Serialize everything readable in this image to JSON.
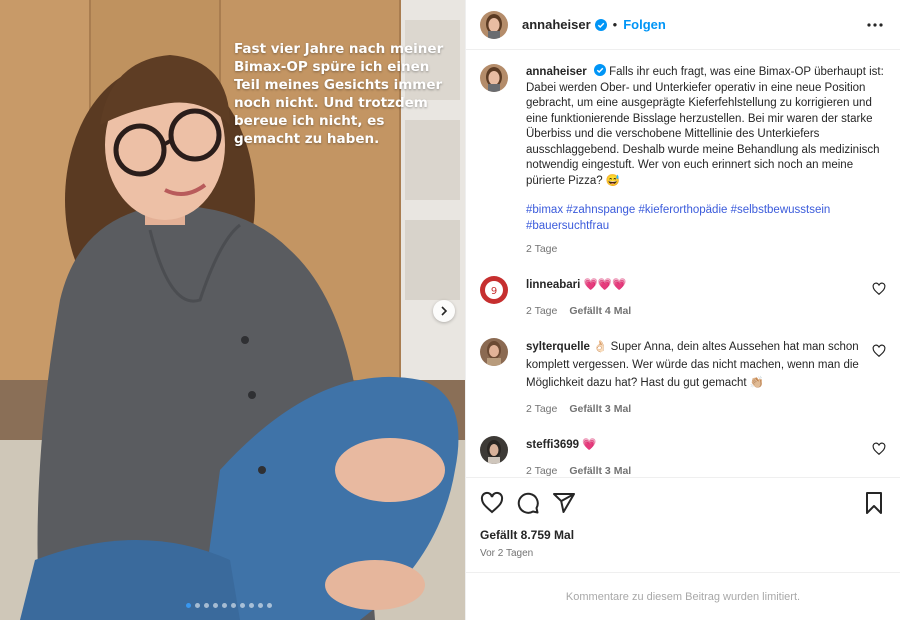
{
  "post": {
    "username": "annaheiser",
    "follow_label": "Folgen",
    "separator": "•",
    "overlay_text": "Fast vier Jahre nach meiner Bimax-OP spüre ich einen Teil meines Gesichts immer noch nicht. Und trotzdem bereue ich nicht, es gemacht zu haben.",
    "carousel": {
      "slide_count": 10,
      "active_index": 0
    }
  },
  "caption": {
    "username": "annaheiser",
    "text": "Falls ihr euch fragt, was eine Bimax-OP überhaupt ist: Dabei werden Ober- und Unterkiefer operativ in eine neue Position gebracht, um eine ausgeprägte Kieferfehlstellung zu korrigieren und eine funktionierende Bisslage herzustellen. Bei mir waren der starke Überbiss und die verschobene Mittellinie des Unterkiefers ausschlaggebend. Deshalb wurde meine Behandlung als medizinisch notwendig eingestuft. Wer von euch erinnert sich noch an meine pürierte Pizza? 😅",
    "hashtags": "#bimax #zahnspange #kieferorthopädie #selbstbewusstsein #bauersuchtfrau",
    "time": "2 Tage"
  },
  "comments": [
    {
      "username": "linneabari",
      "text": "💗💗💗",
      "time": "2 Tage",
      "likes": "Gefällt 4 Mal"
    },
    {
      "username": "sylterquelle",
      "text": "👌🏻 Super Anna, dein altes Aussehen hat man schon komplett vergessen. Wer würde das nicht machen, wenn man die Möglichkeit dazu hat? Hast du gut gemacht 👏🏼",
      "time": "2 Tage",
      "likes": "Gefällt 3 Mal"
    },
    {
      "username": "steffi3699",
      "text": "💗",
      "time": "2 Tage",
      "likes": "Gefällt 3 Mal"
    }
  ],
  "footer": {
    "likes": "Gefällt 8.759 Mal",
    "posted": "Vor 2 Tagen",
    "comments_limited": "Kommentare zu diesem Beitrag wurden limitiert."
  },
  "colors": {
    "accent": "#0095f6",
    "verified": "#0095f6",
    "heart": "#ff3040"
  },
  "icons": [
    "verified-badge-icon",
    "more-options-icon",
    "carousel-next-icon",
    "heart-icon",
    "comment-icon",
    "share-icon",
    "bookmark-icon"
  ]
}
